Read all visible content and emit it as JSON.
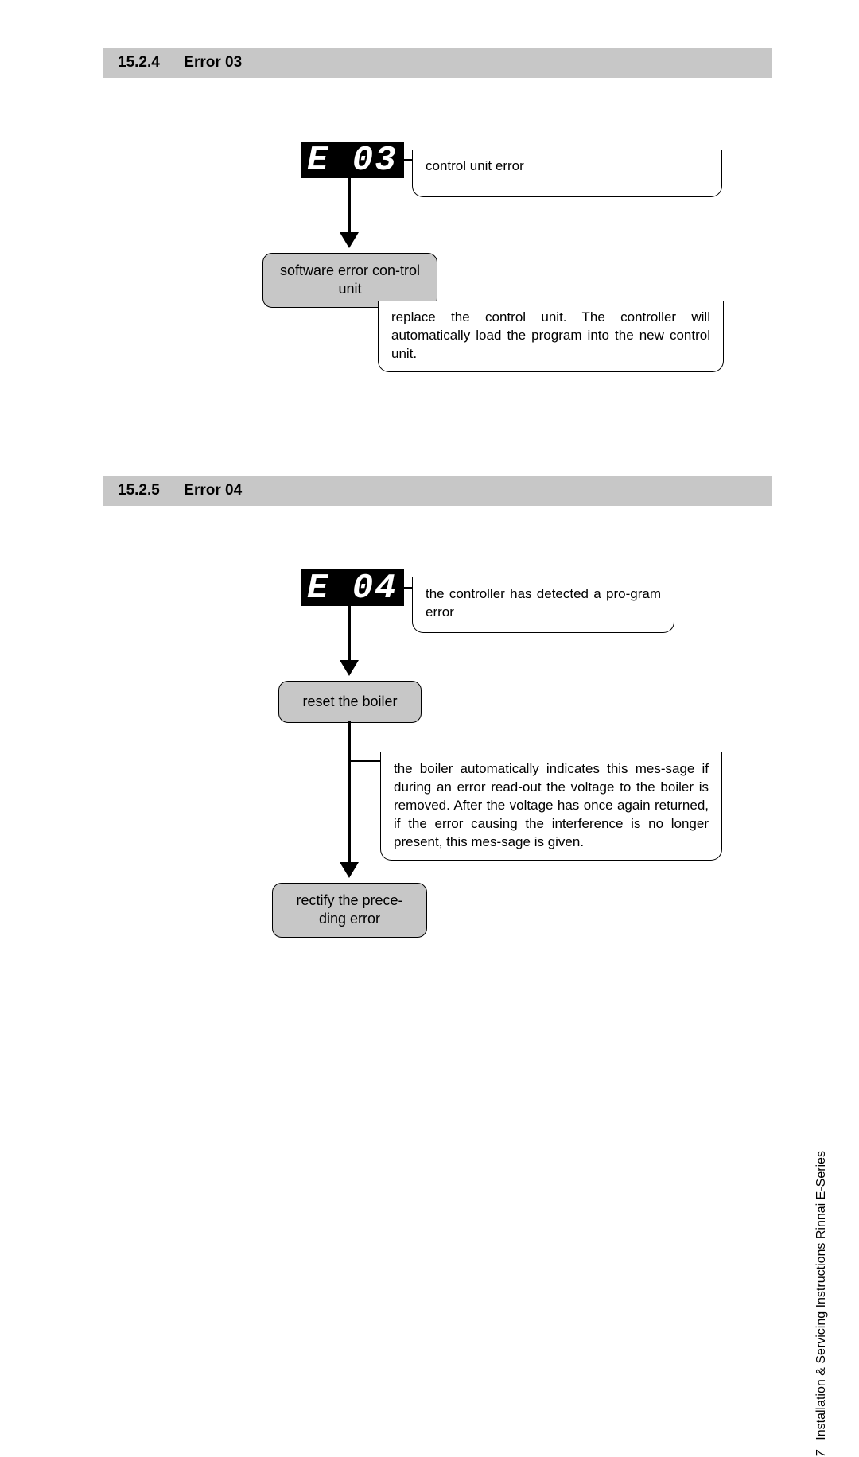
{
  "section1": {
    "number": "15.2.4",
    "title": "Error 03"
  },
  "section2": {
    "number": "15.2.5",
    "title": "Error 04"
  },
  "diagram1": {
    "display": "E 03",
    "info1": "control unit error",
    "step1": "software error con-trol unit",
    "info2": "replace the control unit. The controller will automatically load the program into the new control unit."
  },
  "diagram2": {
    "display": "E 04",
    "info1": "the controller has detected a pro-gram error",
    "step1": "reset the boiler",
    "info2": "the boiler automatically indicates this mes-sage if during an error read-out the voltage to the boiler is removed. After the voltage has once again returned, if the error causing the interference is no longer present, this mes-sage is given.",
    "step2": "rectify the prece-ding error"
  },
  "footer": {
    "page": "7",
    "doc": "Installation & Servicing Instructions Rinnai E-Series"
  }
}
